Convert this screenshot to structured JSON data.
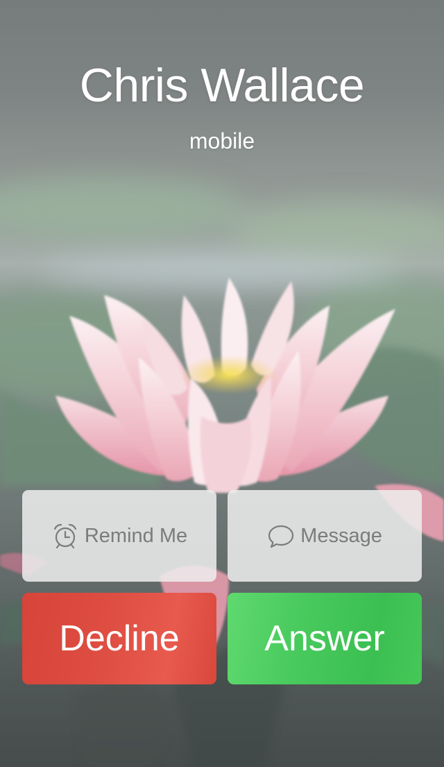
{
  "caller": {
    "name": "Chris Wallace",
    "label": "mobile"
  },
  "actions": {
    "remind": {
      "label": "Remind Me",
      "icon": "alarm-clock-icon"
    },
    "message": {
      "label": "Message",
      "icon": "speech-bubble-icon"
    },
    "decline": {
      "label": "Decline",
      "color": "#dc4a3f"
    },
    "answer": {
      "label": "Answer",
      "color": "#44c758"
    }
  }
}
